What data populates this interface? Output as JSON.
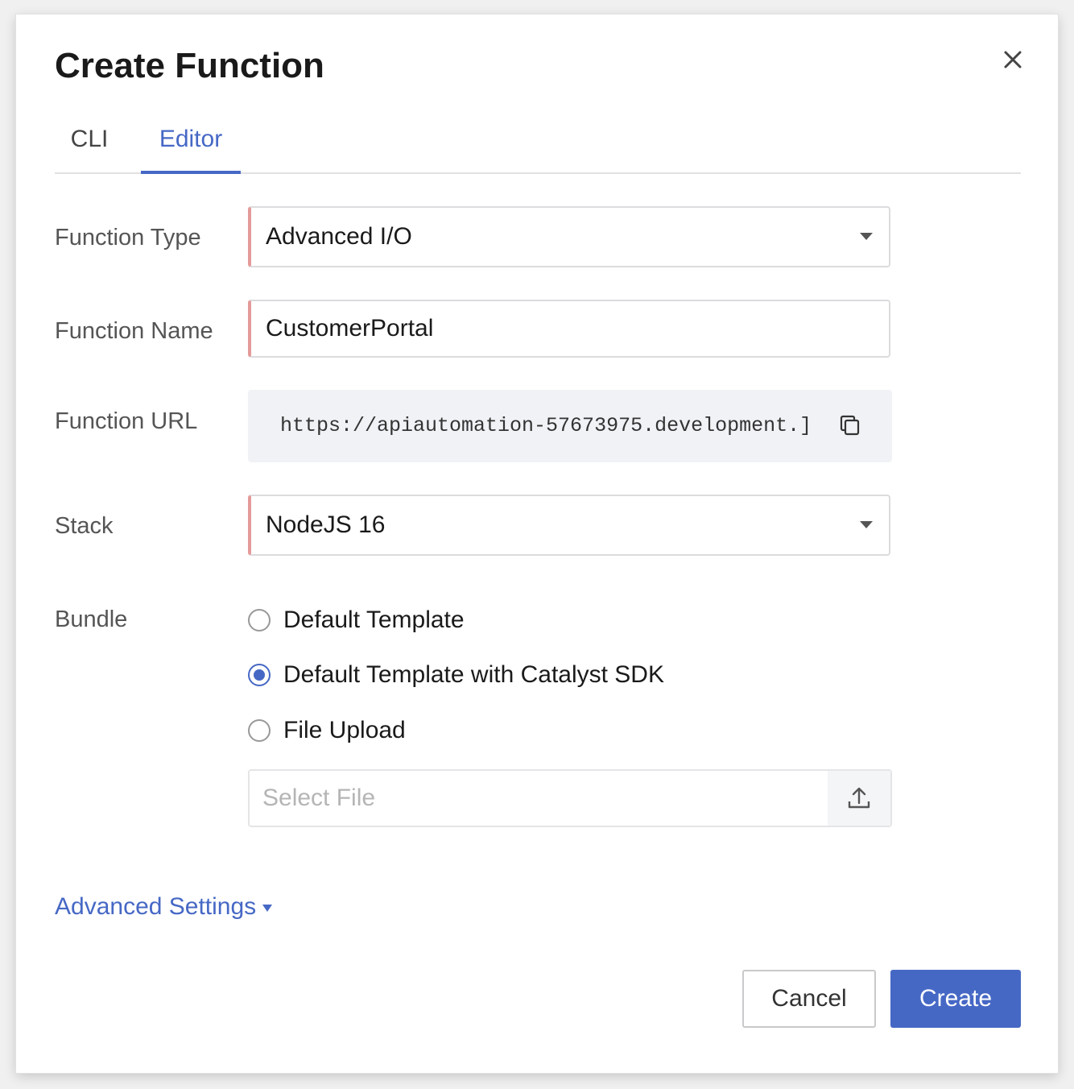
{
  "dialog": {
    "title": "Create Function",
    "close_icon": "close-icon"
  },
  "tabs": [
    {
      "label": "CLI",
      "active": false
    },
    {
      "label": "Editor",
      "active": true
    }
  ],
  "form": {
    "function_type": {
      "label": "Function Type",
      "value": "Advanced I/O"
    },
    "function_name": {
      "label": "Function Name",
      "value": "CustomerPortal"
    },
    "function_url": {
      "label": "Function URL",
      "value": "https://apiautomation-57673975.development.]",
      "icon": "copy-icon"
    },
    "stack": {
      "label": "Stack",
      "value": "NodeJS 16"
    },
    "bundle": {
      "label": "Bundle",
      "options": [
        {
          "label": "Default Template",
          "checked": false
        },
        {
          "label": "Default Template with Catalyst SDK",
          "checked": true
        },
        {
          "label": "File Upload",
          "checked": false
        }
      ],
      "file_placeholder": "Select File",
      "upload_icon": "upload-icon"
    }
  },
  "advanced_settings": "Advanced Settings",
  "buttons": {
    "cancel": "Cancel",
    "create": "Create"
  },
  "colors": {
    "accent": "#4668c5",
    "required_marker": "#e59a9a"
  }
}
